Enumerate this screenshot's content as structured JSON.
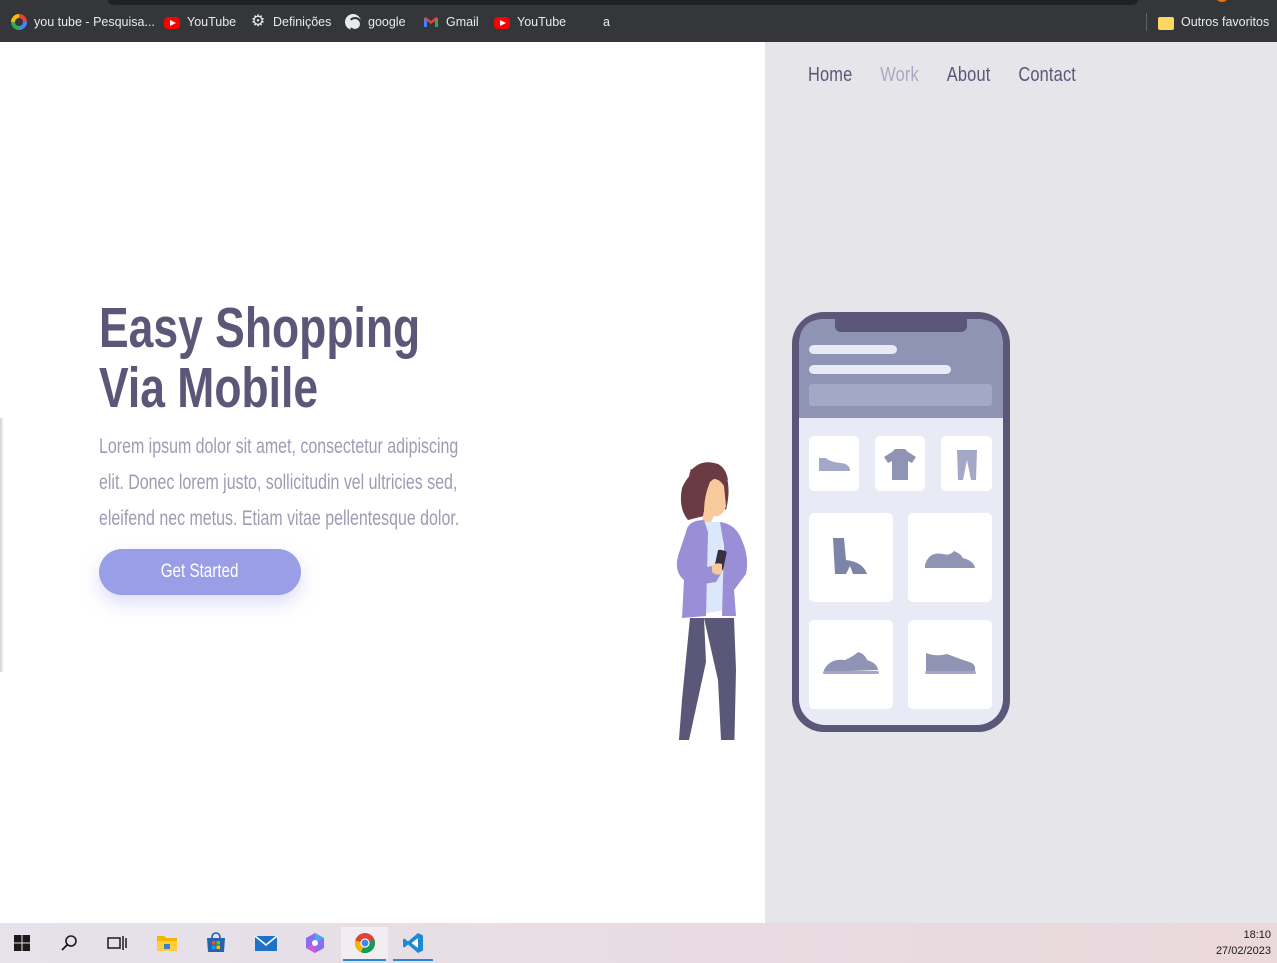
{
  "bookmarks": [
    {
      "label": "you tube - Pesquisa...",
      "icon": "google-icon"
    },
    {
      "label": "YouTube",
      "icon": "youtube-icon"
    },
    {
      "label": "Definições",
      "icon": "gear-icon"
    },
    {
      "label": "google",
      "icon": "globe-icon"
    },
    {
      "label": "Gmail",
      "icon": "gmail-icon"
    },
    {
      "label": "YouTube",
      "icon": "youtube-icon"
    },
    {
      "label": "a",
      "icon": "microsoft-icon"
    }
  ],
  "other_bookmarks": {
    "label": "Outros favoritos",
    "icon": "folder-icon"
  },
  "nav": {
    "home": "Home",
    "work": "Work",
    "about": "About",
    "contact": "Contact"
  },
  "hero": {
    "title_line1": "Easy Shopping",
    "title_line2": "Via Mobile",
    "text_line1": "Lorem ipsum dolor sit amet, consectetur adipiscing",
    "text_line2": "elit. Donec lorem justo, sollicitudin vel ultricies sed,",
    "text_line3": "eleifend nec metus. Etiam vitae pellentesque dolor.",
    "cta": "Get Started"
  },
  "taskbar": {
    "apps": [
      "start-icon",
      "search-icon",
      "task-view-icon",
      "file-explorer-icon",
      "microsoft-store-icon",
      "mail-icon",
      "copilot-icon",
      "chrome-icon",
      "vscode-icon"
    ],
    "time": "18:10",
    "date": "27/02/2023"
  },
  "colors": {
    "title": "#5b5778",
    "text": "#9e9cb3",
    "accent": "#9a9ee6",
    "nav_active": "#a9a8c4",
    "panel": "#e6e5ea"
  }
}
